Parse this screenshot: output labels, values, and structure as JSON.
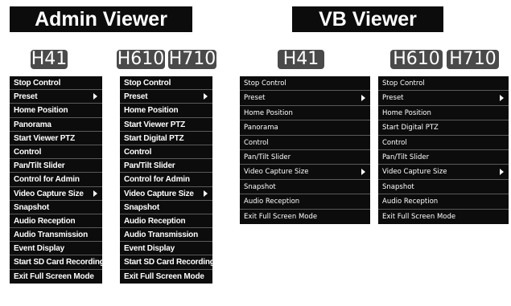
{
  "admin_viewer": {
    "title": "Admin Viewer",
    "left_badge": "H41",
    "right_badges": [
      "H610",
      "H710"
    ],
    "menu_h41": [
      {
        "label": "Stop Control",
        "submenu": false
      },
      {
        "label": "Preset",
        "submenu": true
      },
      {
        "label": "Home Position",
        "submenu": false
      },
      {
        "label": "Panorama",
        "submenu": false
      },
      {
        "label": "Start Viewer PTZ",
        "submenu": false
      },
      {
        "label": "Control",
        "submenu": false
      },
      {
        "label": "Pan/Tilt Slider",
        "submenu": false
      },
      {
        "label": "Control for Admin",
        "submenu": false
      },
      {
        "label": "Video Capture Size",
        "submenu": true
      },
      {
        "label": "Snapshot",
        "submenu": false
      },
      {
        "label": "Audio Reception",
        "submenu": false
      },
      {
        "label": "Audio Transmission",
        "submenu": false
      },
      {
        "label": "Event Display",
        "submenu": false
      },
      {
        "label": "Start SD Card Recording",
        "submenu": false
      },
      {
        "label": "Exit Full Screen Mode",
        "submenu": false
      }
    ],
    "menu_h610_h710": [
      {
        "label": "Stop Control",
        "submenu": false
      },
      {
        "label": "Preset",
        "submenu": true
      },
      {
        "label": "Home Position",
        "submenu": false
      },
      {
        "label": "Start Viewer PTZ",
        "submenu": false
      },
      {
        "label": "Start Digital PTZ",
        "submenu": false
      },
      {
        "label": "Control",
        "submenu": false
      },
      {
        "label": "Pan/Tilt Slider",
        "submenu": false
      },
      {
        "label": "Control for Admin",
        "submenu": false
      },
      {
        "label": "Video Capture Size",
        "submenu": true
      },
      {
        "label": "Snapshot",
        "submenu": false
      },
      {
        "label": "Audio Reception",
        "submenu": false
      },
      {
        "label": "Audio Transmission",
        "submenu": false
      },
      {
        "label": "Event Display",
        "submenu": false
      },
      {
        "label": "Start SD Card Recording",
        "submenu": false
      },
      {
        "label": "Exit Full Screen Mode",
        "submenu": false
      }
    ]
  },
  "vb_viewer": {
    "title": "VB Viewer",
    "left_badge": "H41",
    "right_badges": [
      "H610",
      "H710"
    ],
    "menu_h41": [
      {
        "label": "Stop Control",
        "submenu": false
      },
      {
        "label": "Preset",
        "submenu": true
      },
      {
        "label": "Home Position",
        "submenu": false
      },
      {
        "label": "Panorama",
        "submenu": false
      },
      {
        "label": "Control",
        "submenu": false
      },
      {
        "label": "Pan/Tilt Slider",
        "submenu": false
      },
      {
        "label": "Video Capture Size",
        "submenu": true
      },
      {
        "label": "Snapshot",
        "submenu": false
      },
      {
        "label": "Audio Reception",
        "submenu": false
      },
      {
        "label": "Exit Full Screen Mode",
        "submenu": false
      }
    ],
    "menu_h610_h710": [
      {
        "label": "Stop Control",
        "submenu": false
      },
      {
        "label": "Preset",
        "submenu": true
      },
      {
        "label": "Home Position",
        "submenu": false
      },
      {
        "label": "Start Digital PTZ",
        "submenu": false
      },
      {
        "label": "Control",
        "submenu": false
      },
      {
        "label": "Pan/Tilt Slider",
        "submenu": false
      },
      {
        "label": "Video Capture Size",
        "submenu": true
      },
      {
        "label": "Snapshot",
        "submenu": false
      },
      {
        "label": "Audio Reception",
        "submenu": false
      },
      {
        "label": "Exit Full Screen Mode",
        "submenu": false
      }
    ]
  },
  "colors": {
    "menu_background": "#0c0c0c",
    "menu_text": "#ffffff",
    "badge_background": "#4a4a4a",
    "separator": "#5a5a5a"
  },
  "icons": {
    "submenu": "submenu-arrow-icon"
  }
}
